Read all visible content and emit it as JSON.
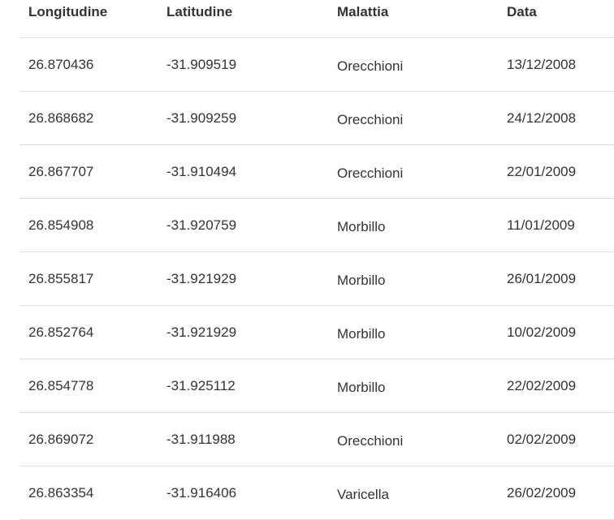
{
  "table": {
    "headers": [
      "Longitudine",
      "Latitudine",
      "Malattia",
      "Data"
    ],
    "rows": [
      [
        "26.870436",
        "-31.909519",
        "Orecchioni",
        "13/12/2008"
      ],
      [
        "26.868682",
        "-31.909259",
        "Orecchioni",
        "24/12/2008"
      ],
      [
        "26.867707",
        "-31.910494",
        "Orecchioni",
        "22/01/2009"
      ],
      [
        "26.854908",
        "-31.920759",
        "Morbillo",
        "11/01/2009"
      ],
      [
        "26.855817",
        "-31.921929",
        "Morbillo",
        "26/01/2009"
      ],
      [
        "26.852764",
        "-31.921929",
        "Morbillo",
        "10/02/2009"
      ],
      [
        "26.854778",
        "-31.925112",
        "Morbillo",
        "22/02/2009"
      ],
      [
        "26.869072",
        "-31.911988",
        "Orecchioni",
        "02/02/2009"
      ],
      [
        "26.863354",
        "-31.916406",
        "Varicella",
        "26/02/2009"
      ]
    ]
  },
  "colors": {
    "text": "#333333",
    "border": "#dddddd",
    "background": "#ffffff"
  }
}
